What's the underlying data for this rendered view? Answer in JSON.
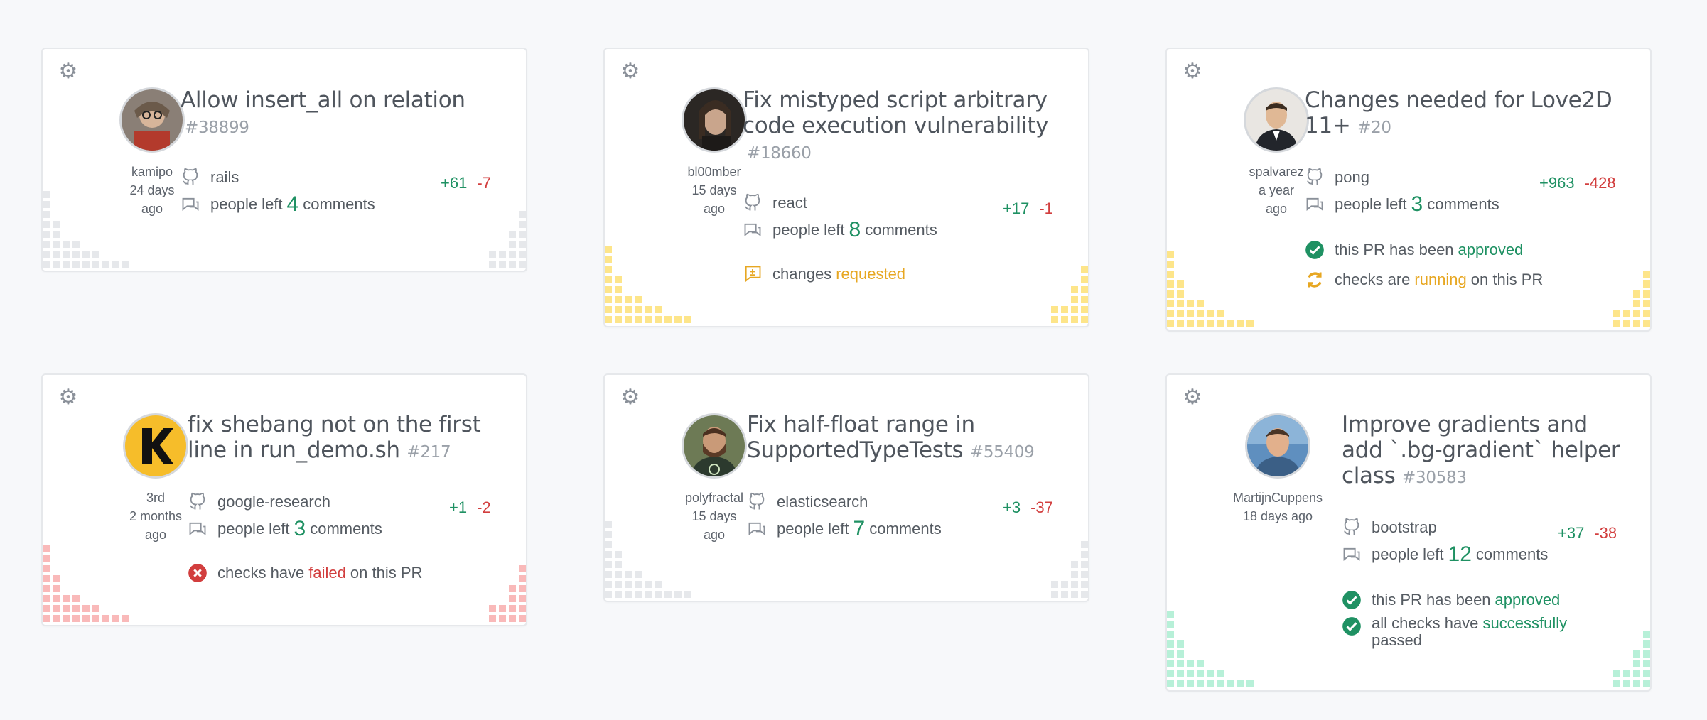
{
  "cards": [
    {
      "title": "Allow insert_all on relation",
      "number": "#38899",
      "user": "kamipo",
      "time_1": "24 days",
      "time_2": "ago",
      "repo": "rails",
      "comments_prefix": "people left",
      "comments_count": "4",
      "comments_suffix": "comments",
      "additions": "+61",
      "deletions": "-7",
      "accent": "#e6e8eb"
    },
    {
      "title": "Fix mistyped script arbitrary code execution vulnerability",
      "number": "#18660",
      "user": "bl00mber",
      "time_1": "15 days",
      "time_2": "ago",
      "repo": "react",
      "comments_prefix": "people left",
      "comments_count": "8",
      "comments_suffix": "comments",
      "additions": "+17",
      "deletions": "-1",
      "status_1": {
        "prefix": "changes",
        "highlight": "requested",
        "suffix": ""
      },
      "accent": "#fde58a"
    },
    {
      "title": "Changes needed for Love2D 11+",
      "number": "#20",
      "user": "spalvarez",
      "time_1": "a year",
      "time_2": "ago",
      "repo": "pong",
      "comments_prefix": "people left",
      "comments_count": "3",
      "comments_suffix": "comments",
      "additions": "+963",
      "deletions": "-428",
      "status_1": {
        "prefix": "this PR has been",
        "highlight": "approved",
        "suffix": ""
      },
      "status_2": {
        "prefix": "checks are",
        "highlight": "running",
        "suffix": "on this PR"
      },
      "accent": "#fde58a"
    },
    {
      "title": "fix shebang not on the first line in run_demo.sh",
      "number": "#217",
      "user": "3rd",
      "time_1": "2 months",
      "time_2": "ago",
      "repo": "google-research",
      "comments_prefix": "people left",
      "comments_count": "3",
      "comments_suffix": "comments",
      "additions": "+1",
      "deletions": "-2",
      "status_1": {
        "prefix": "checks have",
        "highlight": "failed",
        "suffix": "on this PR"
      },
      "accent": "#f9b9b9"
    },
    {
      "title": "Fix half-float range in SupportedTypeTests",
      "number": "#55409",
      "user": "polyfractal",
      "time_1": "15 days",
      "time_2": "ago",
      "repo": "elasticsearch",
      "comments_prefix": "people left",
      "comments_count": "7",
      "comments_suffix": "comments",
      "additions": "+3",
      "deletions": "-37",
      "accent": "#e6e8eb"
    },
    {
      "title": "Improve gradients and add `.bg-gradient` helper class",
      "number": "#30583",
      "user": "MartijnCuppens",
      "time_1": "18 days ago",
      "time_2": "",
      "repo": "bootstrap",
      "comments_prefix": "people left",
      "comments_count": "12",
      "comments_suffix": "comments",
      "additions": "+37",
      "deletions": "-38",
      "status_1": {
        "prefix": "this PR has been",
        "highlight": "approved",
        "suffix": ""
      },
      "status_2": {
        "prefix": "all checks have",
        "highlight": "successfully",
        "suffix": "passed"
      },
      "accent": "#b7f0d8"
    }
  ],
  "colors": {
    "green": "#1f9163",
    "red": "#d23e3e",
    "orange": "#e7a722"
  }
}
